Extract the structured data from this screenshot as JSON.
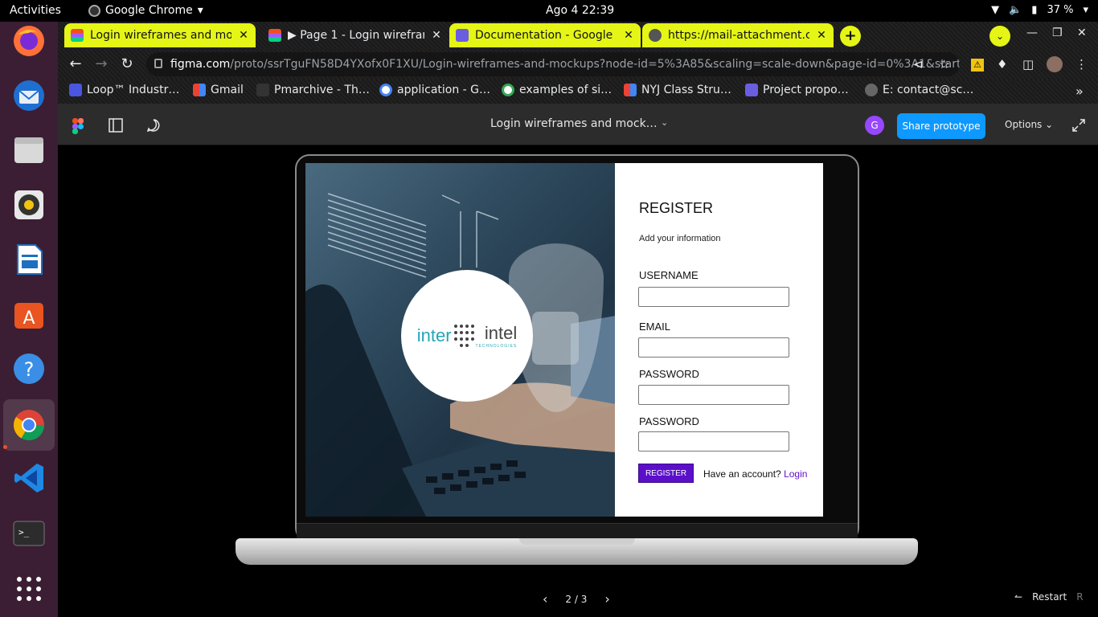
{
  "system": {
    "activities": "Activities",
    "app_name": "Google Chrome",
    "clock": "Ago 4  22:39",
    "battery": "37 %"
  },
  "tabs": [
    {
      "title": "Login wireframes and mo",
      "style": "yellow",
      "favicon": "figma"
    },
    {
      "title": "▶ Page 1 - Login wirefram",
      "style": "dark",
      "favicon": "figma"
    },
    {
      "title": "Documentation - Google I",
      "style": "yellow",
      "favicon": "docs"
    },
    {
      "title": "https://mail-attachment.c",
      "style": "yellow",
      "favicon": "globe"
    }
  ],
  "omnibox": {
    "host": "figma.com",
    "path": "/proto/ssrTguFN58D4YXofx0F1XU/Login-wireframes-and-mockups?node-id=5%3A85&scaling=scale-down&page-id=0%3A1&startin…"
  },
  "bookmarks": [
    {
      "label": "Loop™ Industr…",
      "icon": "loop-icon"
    },
    {
      "label": "Gmail",
      "icon": "gmail-icon"
    },
    {
      "label": "Pmarchive - Th…",
      "icon": "pm-icon"
    },
    {
      "label": "application - G…",
      "icon": "google-icon"
    },
    {
      "label": "examples of si…",
      "icon": "google-icon"
    },
    {
      "label": "NYJ Class Stru…",
      "icon": "gmail-icon"
    },
    {
      "label": "Project propo…",
      "icon": "docs-icon"
    },
    {
      "label": "E: contact@sc…",
      "icon": "globe-icon"
    }
  ],
  "figma": {
    "file_title": "Login wireframes and mock…",
    "avatar_letter": "G",
    "share_label": "Share prototype",
    "options_label": "Options"
  },
  "mockup": {
    "logo_part1": "inter",
    "logo_part2": "intel",
    "logo_sub": "TECHNOLOGIES",
    "title": "REGISTER",
    "subtitle": "Add your information",
    "labels": [
      "USERNAME",
      "EMAIL",
      "PASSWORD",
      "PASSWORD"
    ],
    "button": "REGISTER",
    "have_account": "Have an account?",
    "login_link": "Login"
  },
  "footer": {
    "page_indicator": "2 / 3",
    "restart_label": "Restart",
    "restart_key": "R"
  },
  "colors": {
    "tab_accent": "#e5f516",
    "figma_blue": "#0d99ff",
    "register_purple": "#5b0fc9"
  }
}
